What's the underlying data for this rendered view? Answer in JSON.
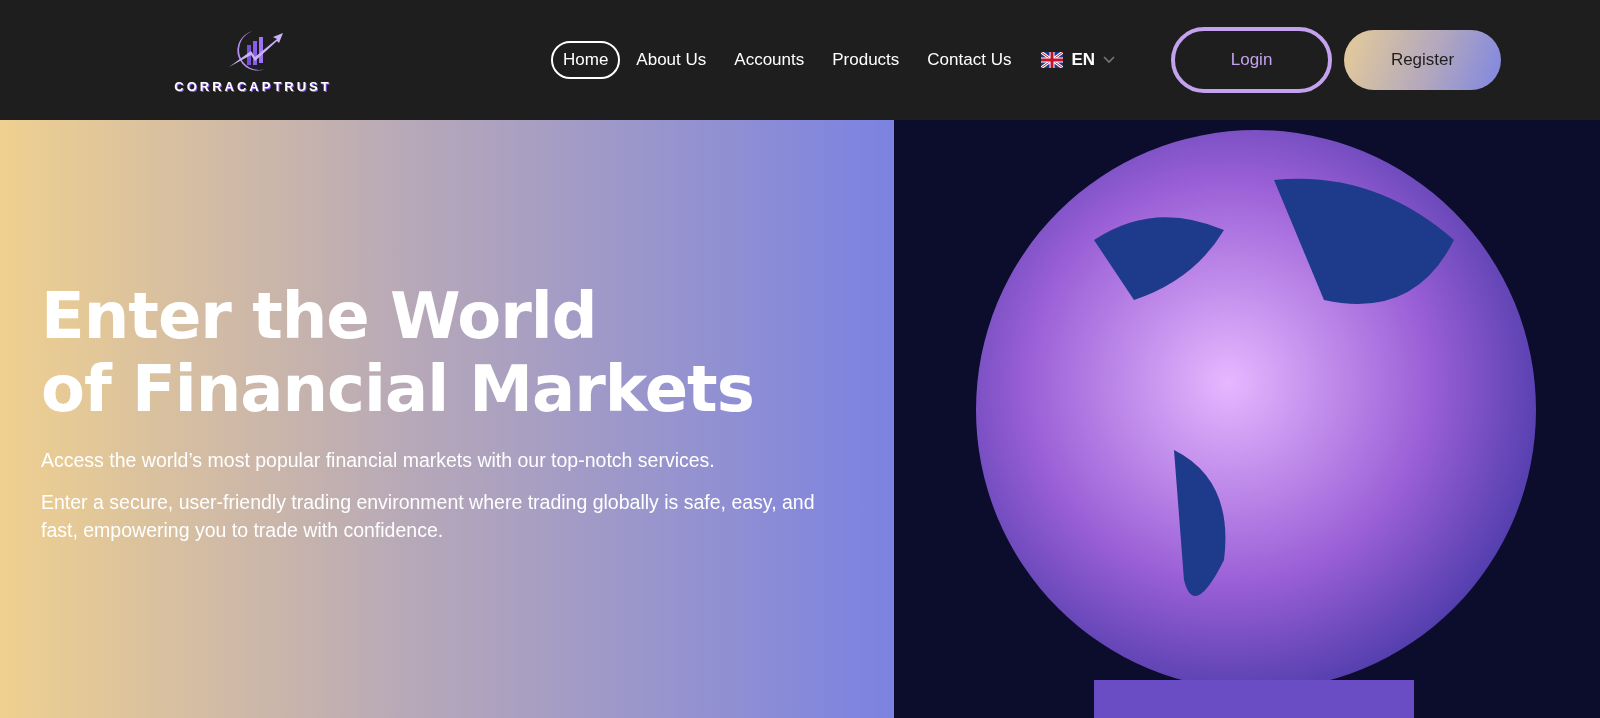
{
  "header": {
    "logo_text": "CORRACAPTRUST",
    "nav": [
      {
        "label": "Home",
        "selected": true
      },
      {
        "label": "About Us",
        "selected": false
      },
      {
        "label": "Accounts",
        "selected": false
      },
      {
        "label": "Products",
        "selected": false
      },
      {
        "label": "Contact Us",
        "selected": false
      }
    ],
    "language": "EN",
    "login": "Login",
    "register": "Register"
  },
  "hero": {
    "title_lines": [
      "Enter the World",
      "of Financial Markets"
    ],
    "paragraphs": [
      "Access the world’s most popular financial markets with our top-notch services.",
      "Enter a secure, user-friendly trading environment where trading globally is safe, easy, and fast, empowering you to trade with confidence."
    ]
  }
}
